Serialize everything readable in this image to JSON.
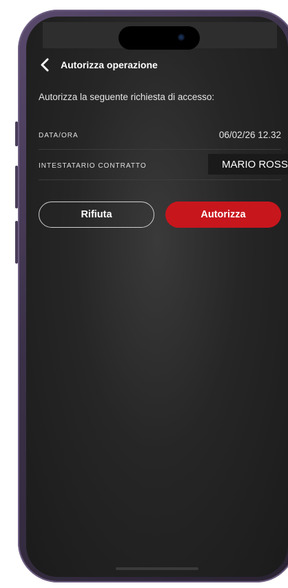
{
  "header": {
    "back_icon": "chevron-left-icon",
    "title": "Autorizza operazione"
  },
  "intro": "Autorizza la seguente richiesta di accesso:",
  "details": [
    {
      "label": "DATA/ORA",
      "value": "06/02/26 12.32"
    },
    {
      "label": "INTESTATARIO CONTRATTO",
      "value": "MARIO ROSSI"
    }
  ],
  "actions": {
    "reject_label": "Rifiuta",
    "accept_label": "Autorizza"
  },
  "colors": {
    "accent": "#c8161d",
    "background": "#262626",
    "frame": "#3b3148"
  }
}
